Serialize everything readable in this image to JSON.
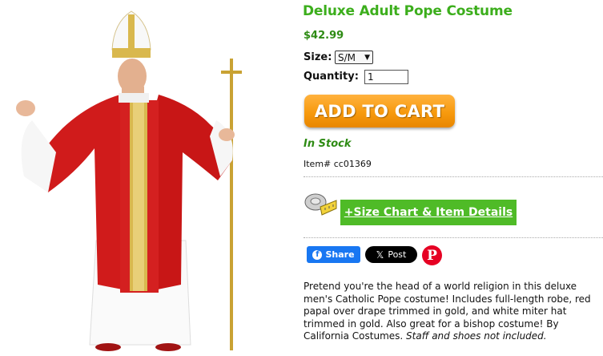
{
  "product": {
    "title": "Deluxe Adult Pope Costume",
    "price": "$42.99",
    "size_label": "Size:",
    "size_selected": "S/M",
    "quantity_label": "Quantity:",
    "quantity_value": "1",
    "add_to_cart": "ADD TO CART",
    "stock": "In Stock",
    "item_number": "Item# cc01369",
    "size_chart": "+Size Chart & Item Details",
    "description": "Pretend you're the head of a world religion in this deluxe men's Catholic Pope costume! Includes full-length robe, red papal over drape trimmed in gold, and white miter hat trimmed in gold. Also great for a bishop costume! By California Costumes. ",
    "description_note": "Staff and shoes not included."
  },
  "social": {
    "facebook_label": "Share",
    "x_label": "Post"
  },
  "colors": {
    "title_green": "#3cae1c",
    "cart_orange": "#f79a0e",
    "size_chart_green": "#4fbb27",
    "facebook_blue": "#1877f2",
    "pinterest_red": "#e60023"
  },
  "icons": [
    "measuring-tape-icon",
    "facebook-icon",
    "x-logo-icon",
    "pinterest-icon"
  ]
}
